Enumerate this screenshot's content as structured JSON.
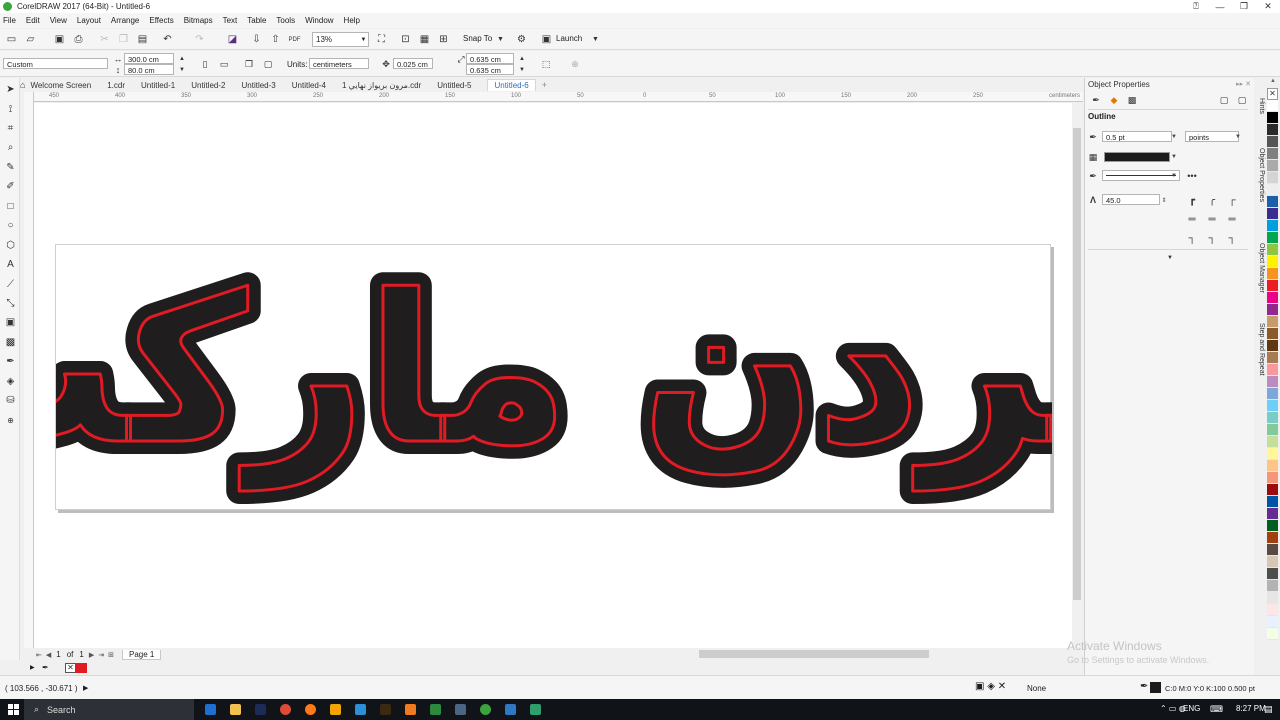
{
  "window": {
    "title": "CorelDRAW 2017 (64-Bit) - Untitled-6"
  },
  "menu": [
    "File",
    "Edit",
    "View",
    "Layout",
    "Arrange",
    "Effects",
    "Bitmaps",
    "Text",
    "Table",
    "Tools",
    "Window",
    "Help"
  ],
  "standard_toolbar": {
    "zoom": "13%",
    "snap_to": "Snap To",
    "launch": "Launch"
  },
  "property_bar": {
    "paper_preset": "Custom",
    "page_width": "300.0 cm",
    "page_height": "80.0 cm",
    "units_label": "Units:",
    "units_value": "centimeters",
    "nudge": "0.025 cm",
    "dup_x": "0.635 cm",
    "dup_y": "0.635 cm"
  },
  "tabs": [
    "Welcome Screen",
    "1.cdr",
    "Untitled-1",
    "Untitled-2",
    "Untitled-3",
    "Untitled-4",
    "مرون بريواز نهايي 1.cdr",
    "Untitled-5",
    "Untitled-6"
  ],
  "active_tab": "Untitled-6",
  "ruler": {
    "ticks": [
      "450",
      "400",
      "350",
      "300",
      "250",
      "200",
      "150",
      "100",
      "50",
      "0",
      "50",
      "100",
      "150",
      "200",
      "250"
    ],
    "unit": "centimeters"
  },
  "artwork": {
    "text": "جردن مارکت",
    "fill_color": "#1f1d1e",
    "outline_color": "#e01b24",
    "page_color": "#ffffff"
  },
  "page_nav": {
    "current": "1",
    "of_label": "of",
    "total": "1",
    "page_tab": "Page 1"
  },
  "status": {
    "coords": "( 103.566 , -30.671 )",
    "fill_label": "None",
    "outline_info": "C:0 M:0 Y:0 K:100  0.500 pt"
  },
  "docker": {
    "title": "Object Properties",
    "section": "Outline",
    "width": "0.5 pt",
    "width_unit": "points",
    "outline_color": "#1b1b1b",
    "miter": "45.0",
    "side_tabs": [
      "Hints",
      "Object Properties",
      "Object Manager",
      "Step and Repeat"
    ]
  },
  "palette": [
    "#ffffff",
    "#000000",
    "#2b2b2b",
    "#555555",
    "#808080",
    "#aaaaaa",
    "#d4d4d4",
    "#eeeeee",
    "#1b5faa",
    "#3a2d8f",
    "#00a0e0",
    "#00a651",
    "#8dc63f",
    "#fff200",
    "#f7941d",
    "#ed1c24",
    "#ec008c",
    "#92278f",
    "#c69c6d",
    "#8b5a2b",
    "#603913",
    "#a67c52",
    "#f6989d",
    "#bd8cbf",
    "#7da7d9",
    "#6dcff6",
    "#7accc8",
    "#82ca9c",
    "#c4df9b",
    "#fff799",
    "#fdc689",
    "#f69679",
    "#9e0b0f",
    "#0054a6",
    "#662d91",
    "#005e20",
    "#a0410d",
    "#594a42",
    "#d6c7b4",
    "#4d4d4d",
    "#b3b3b3",
    "#e6e6e6",
    "#ffe6e6",
    "#e6f2ff",
    "#f2ffe6"
  ],
  "watermark": {
    "line1": "Activate Windows",
    "line2": "Go to Settings to activate Windows."
  },
  "taskbar": {
    "search": "Search",
    "language": "ENG",
    "time": "8:27 PM"
  }
}
